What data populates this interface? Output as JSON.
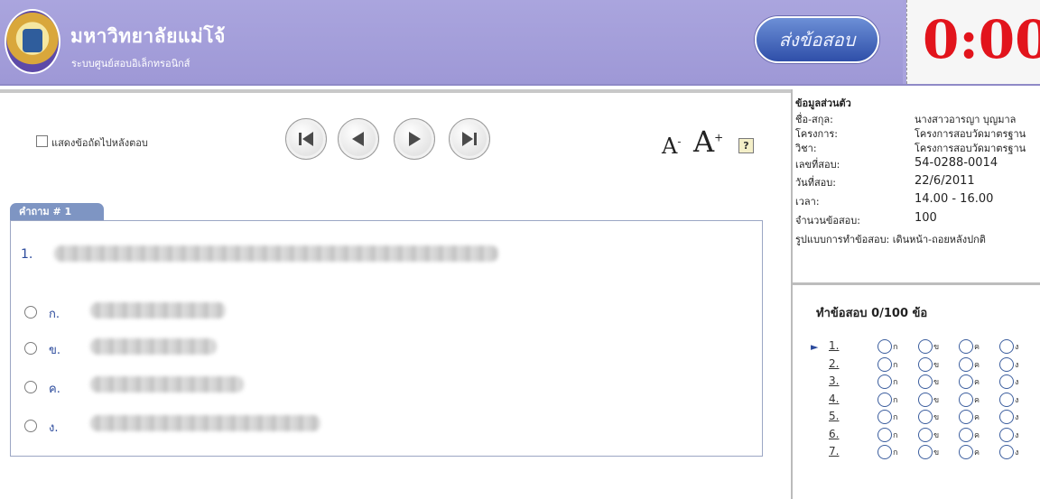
{
  "header": {
    "university_name": "มหาวิทยาลัยแม่โจ้",
    "system_name": "ระบบศูนย์สอบอิเล็กทรอนิกส์",
    "submit_label": "ส่งข้อสอบ",
    "timer": "0:00:"
  },
  "toolbar": {
    "show_checkbox_label": "แสดงข้อถัดไปหลังตอบ",
    "font_small_label": "A",
    "font_big_label": "A",
    "font_small_sup": "-",
    "font_big_sup": "+",
    "help_label": "?"
  },
  "question": {
    "tab_label": "คำถาม # 1",
    "number": "1.",
    "options": [
      {
        "label": "ก."
      },
      {
        "label": "ข."
      },
      {
        "label": "ค."
      },
      {
        "label": "ง."
      }
    ]
  },
  "profile": {
    "title": "ข้อมูลส่วนตัว",
    "rows": [
      {
        "label": "ชื่อ-สกุล:",
        "value": "นางสาวอารญา บุญมาล"
      },
      {
        "label": "โครงการ:",
        "value": "โครงการสอบวัดมาตรฐาน"
      },
      {
        "label": "วิชา:",
        "value": "โครงการสอบวัดมาตรฐาน"
      },
      {
        "label": "เลขที่สอบ:",
        "value": "54-0288-0014"
      },
      {
        "label": "วันที่สอบ:",
        "value": "22/6/2011"
      },
      {
        "label": "เวลา:",
        "value": "14.00 - 16.00"
      },
      {
        "label": "จำนวนข้อสอบ:",
        "value": "100"
      }
    ],
    "format_row": "รูปแบบการทำข้อสอบ: เดินหน้า-ถอยหลังปกติ"
  },
  "answer_sheet": {
    "progress": "ทำข้อสอบ 0/100  ข้อ",
    "choice_letters": [
      "ก",
      "ข",
      "ค",
      "ง"
    ],
    "current_marker": "►",
    "questions": [
      {
        "num": "1."
      },
      {
        "num": "2."
      },
      {
        "num": "3."
      },
      {
        "num": "4."
      },
      {
        "num": "5."
      },
      {
        "num": "6."
      },
      {
        "num": "7."
      }
    ]
  }
}
